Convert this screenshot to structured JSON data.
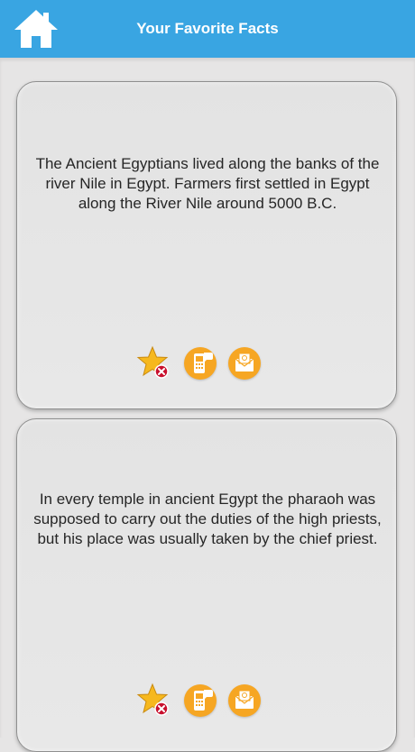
{
  "header": {
    "title": "Your Favorite Facts",
    "home_icon": "home-icon",
    "color": "#39a5e2"
  },
  "facts": [
    {
      "text": "The Ancient Egyptians lived along the banks of the river Nile in Egypt. Farmers first settled in Egypt along the River Nile around 5000 B.C.",
      "actions": [
        "remove-favorite-icon",
        "sms-share-icon",
        "email-share-icon"
      ]
    },
    {
      "text": "In every temple in ancient Egypt the pharaoh was supposed to carry out the duties of the high priests, but his place was usually taken by the chief priest.",
      "actions": [
        "remove-favorite-icon",
        "sms-share-icon",
        "email-share-icon"
      ]
    }
  ],
  "colors": {
    "accent": "#f6a623",
    "background": "#e6e5e5",
    "remove_badge": "#c8102e"
  }
}
